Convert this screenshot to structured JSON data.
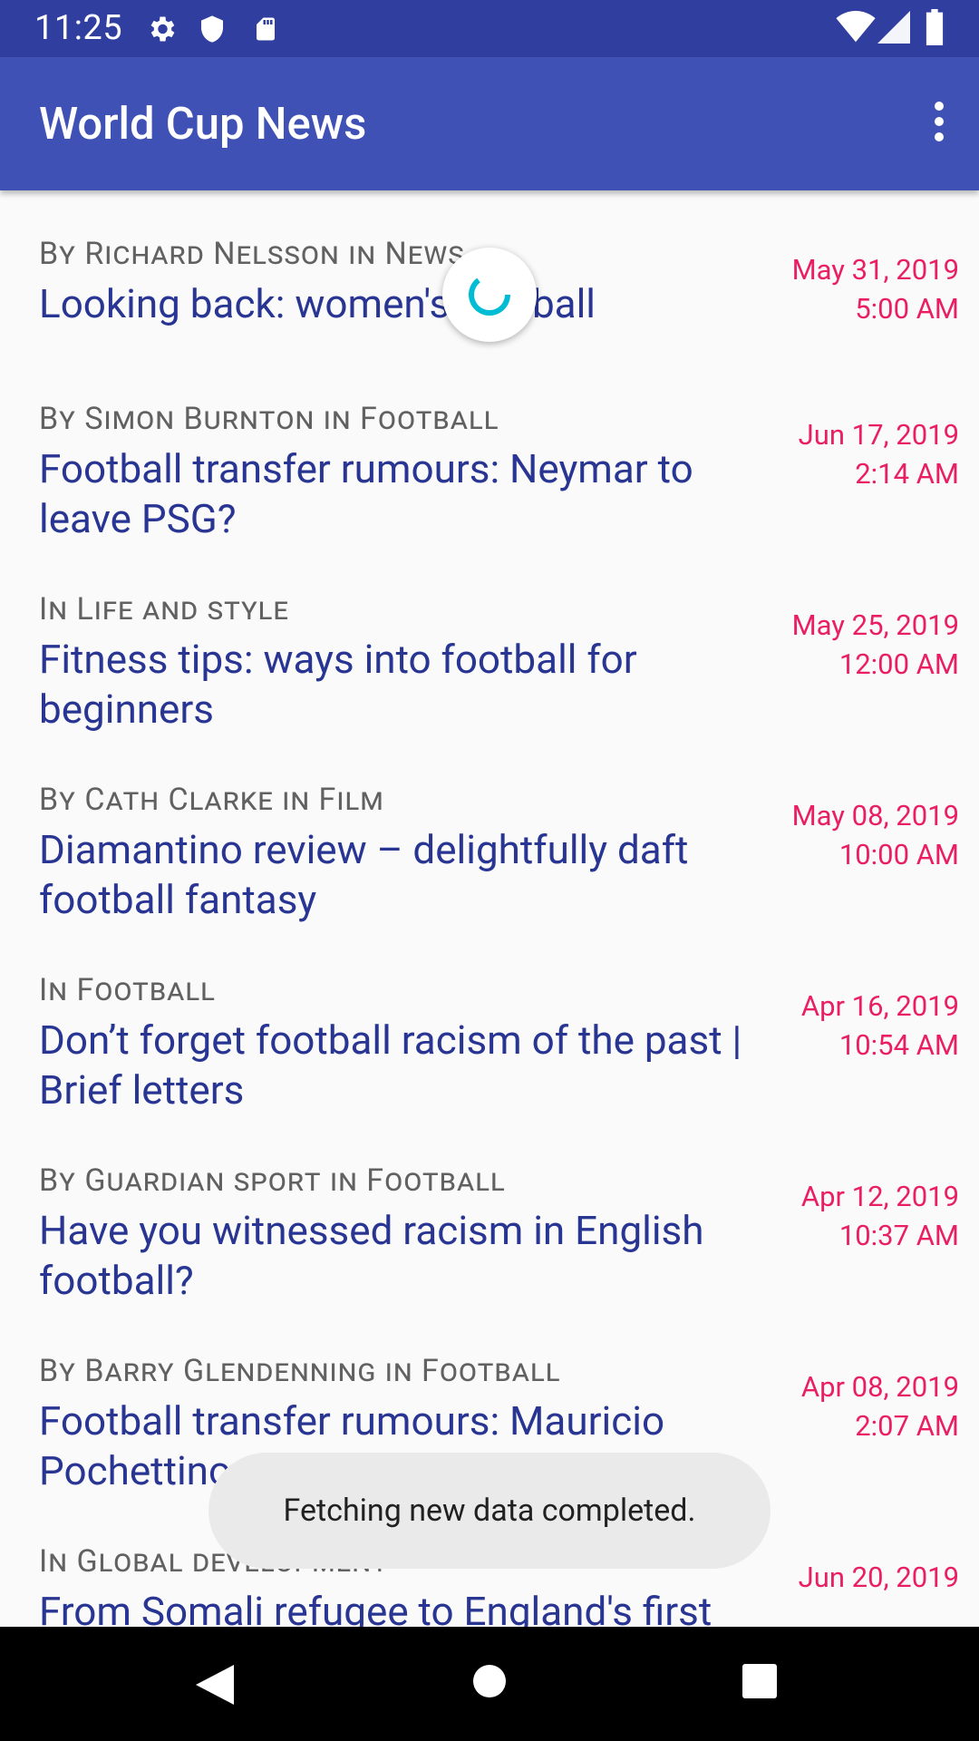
{
  "status_bar": {
    "time": "11:25",
    "icons_left": [
      "settings-icon",
      "shield-icon",
      "sd-card-icon"
    ],
    "icons_right": [
      "wifi-icon",
      "signal-icon",
      "battery-icon"
    ]
  },
  "app_bar": {
    "title": "World Cup News",
    "menu_icon": "more-vert-icon"
  },
  "articles": [
    {
      "byline": "By Richard Nelsson in News",
      "headline": "Looking back: women's football",
      "date": "May 31, 2019",
      "time": "5:00 AM"
    },
    {
      "byline": "By Simon Burnton in Football",
      "headline": "Football transfer rumours: Neymar to leave PSG?",
      "date": "Jun 17, 2019",
      "time": "2:14 AM"
    },
    {
      "byline": "In Life and style",
      "headline": "Fitness tips: ways into football for beginners",
      "date": "May 25, 2019",
      "time": "12:00 AM"
    },
    {
      "byline": "By Cath Clarke in Film",
      "headline": "Diamantino review – delightfully daft football fantasy",
      "date": "May 08, 2019",
      "time": "10:00 AM"
    },
    {
      "byline": "In Football",
      "headline": "Don’t forget football racism of the past | Brief letters",
      "date": "Apr 16, 2019",
      "time": "10:54 AM"
    },
    {
      "byline": "By Guardian sport in Football",
      "headline": "Have you witnessed racism in English football?",
      "date": "Apr 12, 2019",
      "time": "10:37 AM"
    },
    {
      "byline": "By Barry Glendenning in Football",
      "headline": "Football transfer rumours: Mauricio Pochettino to Milan?",
      "date": "Apr 08, 2019",
      "time": "2:07 AM"
    },
    {
      "byline": "In Global development",
      "headline": "From Somali refugee to England's first",
      "date": "Jun 20, 2019",
      "time": ""
    }
  ],
  "toast": {
    "message": "Fetching new data completed."
  },
  "nav_bar": {
    "icons": [
      "back-icon",
      "home-icon",
      "recents-icon"
    ]
  },
  "colors": {
    "status_bar": "#303f9f",
    "app_bar": "#3f51b5",
    "headline": "#283593",
    "date": "#e91e63",
    "spinner": "#00bcd4"
  }
}
